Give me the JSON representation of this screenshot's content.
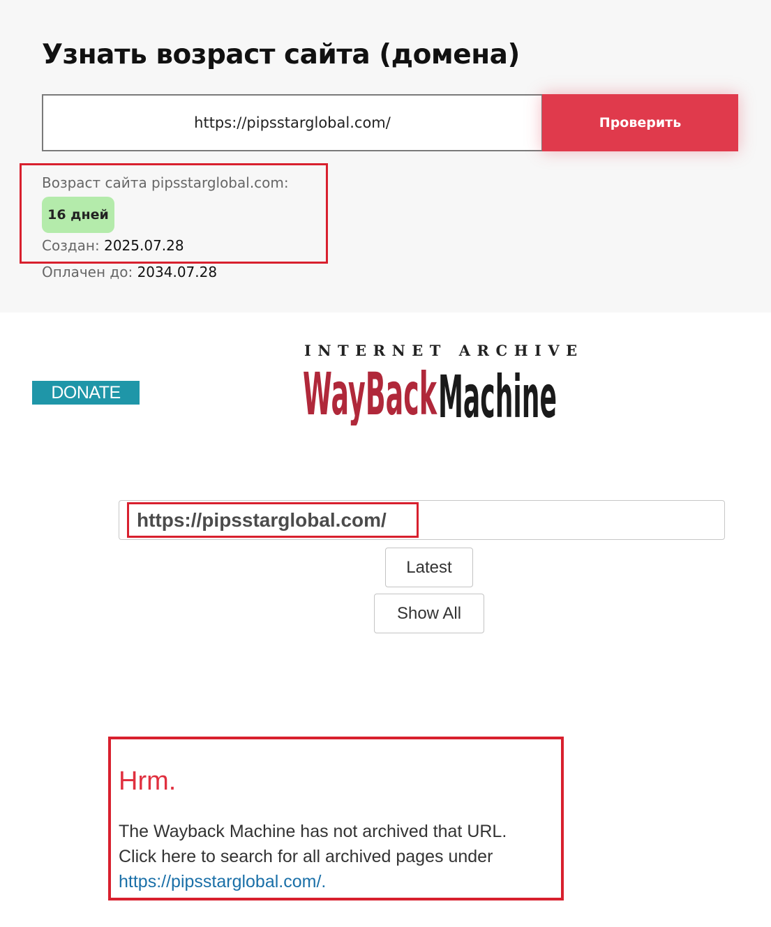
{
  "checker": {
    "title": "Узнать возраст сайта (домена)",
    "input_value": "https://pipsstarglobal.com/",
    "check_button_label": "Проверить",
    "accent_color": "#e03a4c",
    "result": {
      "age_label": "Возраст сайта pipsstarglobal.com:",
      "age_badge": "16 дней",
      "created_label": "Создан:",
      "created_value": "2025.07.28",
      "paid_label": "Оплачен до:",
      "paid_value": "2034.07.28"
    }
  },
  "wayback": {
    "donate_label": "DONATE",
    "logo": {
      "top_text": "INTERNET ARCHIVE",
      "word_1": "WayBack",
      "word_2": "Machine"
    },
    "url_input_value": "https://pipsstarglobal.com/",
    "latest_button_label": "Latest",
    "show_all_button_label": "Show All",
    "error": {
      "heading": "Hrm.",
      "line_1": "The Wayback Machine has not archived that URL.",
      "line_2": "Click here to search for all archived pages under",
      "link_text": "https://pipsstarglobal.com/."
    }
  },
  "highlight_color": "#d8202e"
}
